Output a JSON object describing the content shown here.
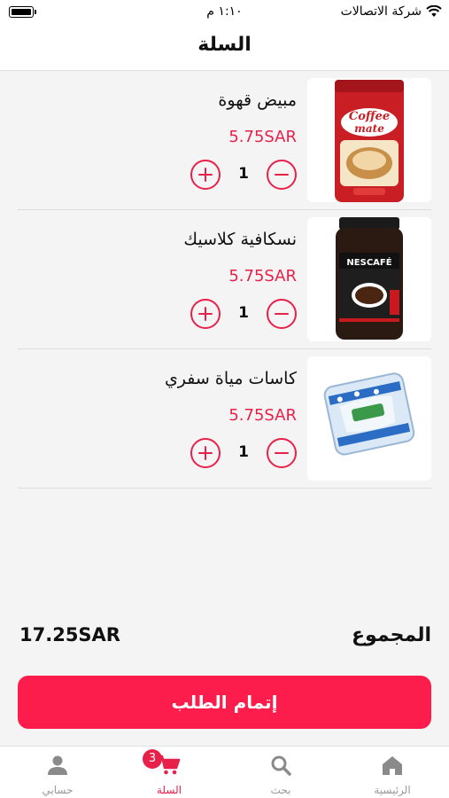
{
  "status_bar": {
    "time": "١:١٠ م",
    "carrier": "شركة الاتصالات"
  },
  "header": {
    "title": "السلة"
  },
  "cart": {
    "items": [
      {
        "name": "مبيض قهوة",
        "price": "5.75SAR",
        "quantity": "1",
        "image": "coffee-mate-jar"
      },
      {
        "name": "نسكافية كلاسيك",
        "price": "5.75SAR",
        "quantity": "1",
        "image": "nescafe-classic-jar"
      },
      {
        "name": "كاسات مياة سفري",
        "price": "5.75SAR",
        "quantity": "1",
        "image": "water-cups-pack"
      }
    ]
  },
  "summary": {
    "total_label": "المجموع",
    "total_value": "17.25SAR"
  },
  "checkout": {
    "label": "إتمام الطلب"
  },
  "tabbar": {
    "items": [
      {
        "label": "الرئيسية",
        "icon": "home-icon"
      },
      {
        "label": "بحث",
        "icon": "search-icon"
      },
      {
        "label": "السلة",
        "icon": "cart-icon",
        "badge": "3",
        "active": true
      },
      {
        "label": "حسابي",
        "icon": "user-icon"
      }
    ]
  },
  "colors": {
    "accent": "#e8214b",
    "button": "#fc1d4c",
    "background": "#f4f4f4"
  }
}
